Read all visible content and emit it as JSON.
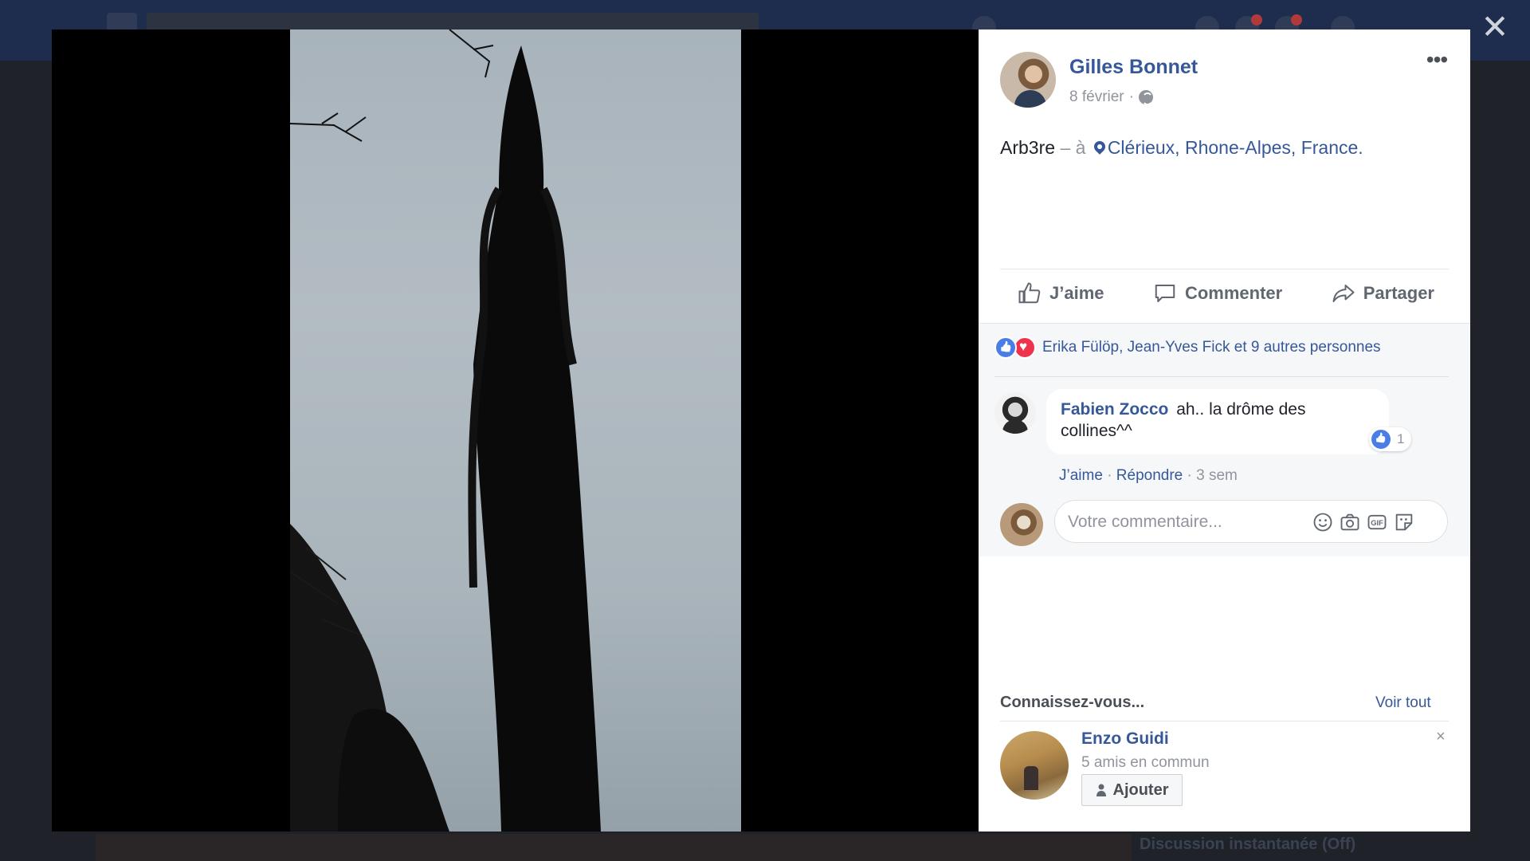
{
  "post": {
    "author": "Gilles Bonnet",
    "date": "8 février",
    "date_sep": "·",
    "text": "Arb3re",
    "at_sep": "– à",
    "location": "Clérieux, Rhone-Alpes, France.",
    "privacy_icon": "globe-icon",
    "more_label": "•••"
  },
  "actions": {
    "like": "J’aime",
    "comment": "Commenter",
    "share": "Partager"
  },
  "reactions": {
    "summary": "Erika Fülöp, Jean-Yves Fick et 9 autres personnes",
    "types": [
      "like",
      "love"
    ]
  },
  "comment": {
    "author": "Fabien Zocco",
    "text": "ah.. la drôme des collines^^",
    "like_count": "1",
    "like_link": "J’aime",
    "dot1": "·",
    "reply_link": "Répondre",
    "dot2": "·",
    "age": "3 sem"
  },
  "reply": {
    "placeholder": "Votre commentaire..."
  },
  "pymk": {
    "title": "Connaissez-vous...",
    "see_all": "Voir tout",
    "name": "Enzo Guidi",
    "mutual": "5 amis en commun",
    "add": "Ajouter",
    "dismiss": "×"
  },
  "background": {
    "chat": "Discussion instantanée (Off)"
  },
  "viewer": {
    "close": "✕"
  },
  "colors": {
    "link": "#365899",
    "muted": "#90949c",
    "like_blue": "#4a7de6",
    "love_red": "#f0334d"
  }
}
